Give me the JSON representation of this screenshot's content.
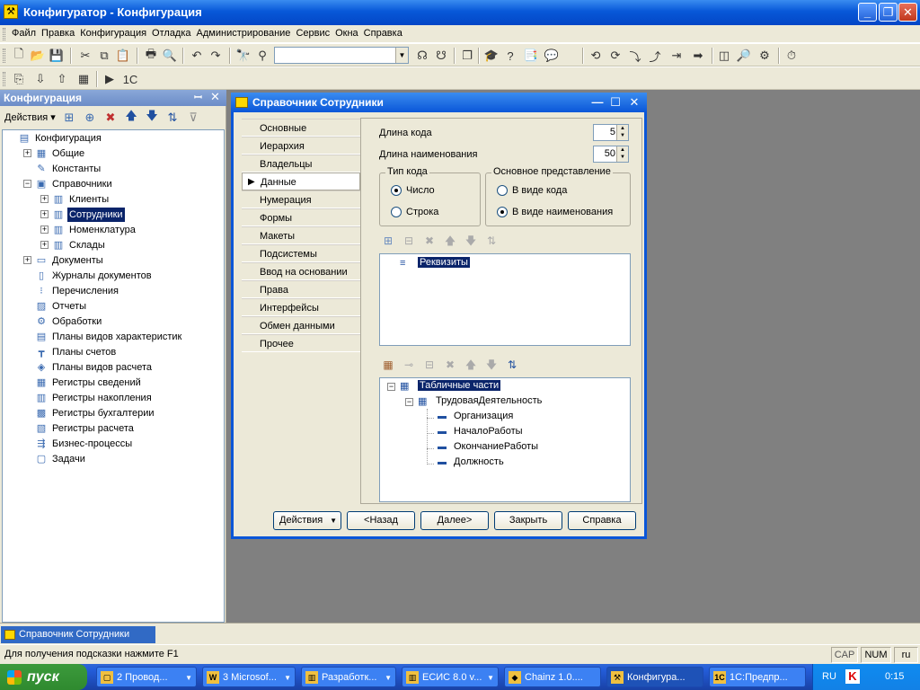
{
  "window": {
    "title": "Конфигуратор - Конфигурация",
    "controls": {
      "min": "_",
      "max": "❐",
      "close": "✕"
    }
  },
  "menu": [
    "Файл",
    "Правка",
    "Конфигурация",
    "Отладка",
    "Администрирование",
    "Сервис",
    "Окна",
    "Справка"
  ],
  "left_panel": {
    "title": "Конфигурация",
    "pin": "ꟷ",
    "close": "✕",
    "actions_label": "Действия ▾",
    "tree": [
      {
        "label": "Конфигурация",
        "icon": "config-icon",
        "level": 0,
        "expander": ""
      },
      {
        "label": "Общие",
        "icon": "folder-icon",
        "level": 1,
        "expander": "+"
      },
      {
        "label": "Константы",
        "icon": "constant-icon",
        "level": 1,
        "expander": ""
      },
      {
        "label": "Справочники",
        "icon": "catalog-icon",
        "level": 1,
        "expander": "−"
      },
      {
        "label": "Клиенты",
        "icon": "catalog-item-icon",
        "level": 2,
        "expander": "+"
      },
      {
        "label": "Сотрудники",
        "icon": "catalog-item-icon",
        "level": 2,
        "expander": "+",
        "selected": true
      },
      {
        "label": "Номенклатура",
        "icon": "catalog-item-icon",
        "level": 2,
        "expander": "+"
      },
      {
        "label": "Склады",
        "icon": "catalog-item-icon",
        "level": 2,
        "expander": "+"
      },
      {
        "label": "Документы",
        "icon": "document-icon",
        "level": 1,
        "expander": "+"
      },
      {
        "label": "Журналы документов",
        "icon": "journal-icon",
        "level": 1,
        "expander": ""
      },
      {
        "label": "Перечисления",
        "icon": "enum-icon",
        "level": 1,
        "expander": ""
      },
      {
        "label": "Отчеты",
        "icon": "report-icon",
        "level": 1,
        "expander": ""
      },
      {
        "label": "Обработки",
        "icon": "processing-icon",
        "level": 1,
        "expander": ""
      },
      {
        "label": "Планы видов характеристик",
        "icon": "chart-of-char-icon",
        "level": 1,
        "expander": ""
      },
      {
        "label": "Планы счетов",
        "icon": "chart-of-accounts-icon",
        "level": 1,
        "expander": ""
      },
      {
        "label": "Планы видов расчета",
        "icon": "calc-types-icon",
        "level": 1,
        "expander": ""
      },
      {
        "label": "Регистры сведений",
        "icon": "info-register-icon",
        "level": 1,
        "expander": ""
      },
      {
        "label": "Регистры накопления",
        "icon": "accum-register-icon",
        "level": 1,
        "expander": ""
      },
      {
        "label": "Регистры бухгалтерии",
        "icon": "account-register-icon",
        "level": 1,
        "expander": ""
      },
      {
        "label": "Регистры расчета",
        "icon": "calc-register-icon",
        "level": 1,
        "expander": ""
      },
      {
        "label": "Бизнес-процессы",
        "icon": "business-process-icon",
        "level": 1,
        "expander": ""
      },
      {
        "label": "Задачи",
        "icon": "task-icon",
        "level": 1,
        "expander": ""
      }
    ]
  },
  "dialog": {
    "title": "Справочник Сотрудники",
    "tabs": [
      "Основные",
      "Иерархия",
      "Владельцы",
      "Данные",
      "Нумерация",
      "Формы",
      "Макеты",
      "Подсистемы",
      "Ввод на основании",
      "Права",
      "Интерфейсы",
      "Обмен данными",
      "Прочее"
    ],
    "active_tab_index": 3,
    "code_length_label": "Длина кода",
    "code_length_value": "5",
    "name_length_label": "Длина наименования",
    "name_length_value": "50",
    "code_type": {
      "title": "Тип кода",
      "options": [
        "Число",
        "Строка"
      ],
      "selected": 0
    },
    "main_repr": {
      "title": "Основное представление",
      "options": [
        "В виде кода",
        "В виде наименования"
      ],
      "selected": 1
    },
    "attributes_root": "Реквизиты",
    "tabular_root": "Табличные части",
    "tabular_child": "ТрудоваяДеятельность",
    "tabular_fields": [
      "Организация",
      "НачалоРаботы",
      "ОкончаниеРаботы",
      "Должность"
    ],
    "buttons": {
      "actions": "Действия",
      "back": "<Назад",
      "next": "Далее>",
      "close": "Закрыть",
      "help": "Справка"
    }
  },
  "mdi_tab": "Справочник Сотрудники",
  "status": {
    "hint": "Для получения подсказки нажмите F1",
    "cap": "CAP",
    "num": "NUM",
    "lang": "ru"
  },
  "taskbar": {
    "start": "пуск",
    "tasks": [
      "2 Провод...",
      "3 Microsof...",
      "Разработк...",
      "ЕСИС 8.0 v...",
      "Chainz 1.0....",
      "Конфигура...",
      "1С:Предпр..."
    ],
    "active_task_index": 5,
    "tray_lang": "RU",
    "clock": "0:15"
  }
}
